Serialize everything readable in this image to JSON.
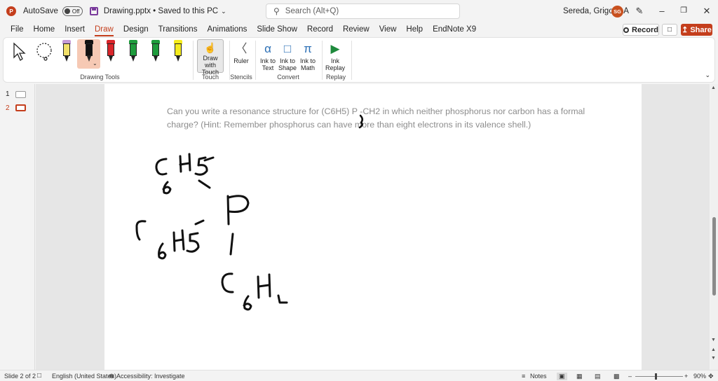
{
  "titlebar": {
    "app_icon": "P",
    "autosave_label": "AutoSave",
    "autosave_state": "Off",
    "document_title": "Drawing.pptx • Saved to this PC",
    "search_placeholder": "Search (Alt+Q)",
    "user_name": "Sereda, Grigoriy A",
    "user_initials": "SG"
  },
  "tabs": [
    "File",
    "Home",
    "Insert",
    "Draw",
    "Design",
    "Transitions",
    "Animations",
    "Slide Show",
    "Record",
    "Review",
    "View",
    "Help",
    "EndNote X9"
  ],
  "active_tab": "Draw",
  "actions": {
    "record": "Record",
    "share": "Share"
  },
  "ribbon": {
    "groups": {
      "drawing_tools": "Drawing Tools",
      "touch": "Touch",
      "stencils": "Stencils",
      "convert": "Convert",
      "replay": "Replay"
    },
    "draw_with_touch": "Draw with Touch",
    "ruler": "Ruler",
    "ink_to_text": "Ink to Text",
    "ink_to_shape": "Ink to Shape",
    "ink_to_math": "Ink to Math",
    "ink_replay": "Ink Replay",
    "pens": [
      {
        "cap": "#c59bd6",
        "body": "#f2e06a"
      },
      {
        "cap": "#111111",
        "body": "#111111"
      },
      {
        "cap": "#d9262b",
        "body": "#d9262b"
      },
      {
        "cap": "#1e9b3c",
        "body": "#1e9b3c"
      },
      {
        "cap": "#1e9b3c",
        "body": "#1e9b3c"
      },
      {
        "cap": "#f5ec1d",
        "body": "#f5ec1d"
      }
    ]
  },
  "slides": {
    "items": [
      "1",
      "2"
    ],
    "active": "2"
  },
  "slide": {
    "question": "Can you write a resonance structure for (C6H5) P -CH2 in which neither phosphorus nor carbon has a formal charge? (Hint: Remember phosphorus can have more than eight electrons in its valence shell.)"
  },
  "status": {
    "slide_counter": "Slide 2 of 2",
    "language": "English (United States)",
    "accessibility": "Accessibility: Investigate",
    "notes": "Notes",
    "zoom": "90%"
  },
  "colors": {
    "accent": "#c43e1c",
    "ink": "#111111"
  }
}
